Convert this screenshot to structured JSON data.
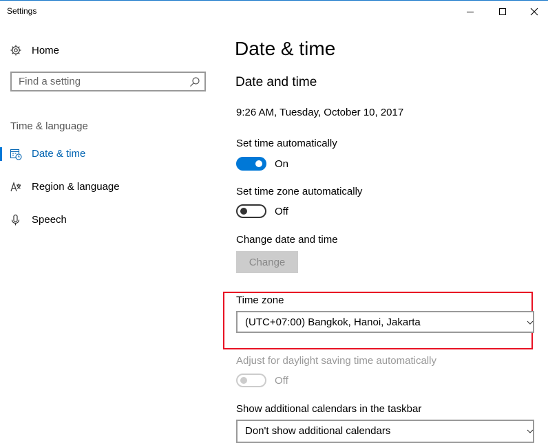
{
  "window": {
    "title": "Settings"
  },
  "sidebar": {
    "home_label": "Home",
    "search_placeholder": "Find a setting",
    "section_label": "Time & language",
    "items": [
      {
        "label": "Date & time",
        "icon": "calendar-clock-icon",
        "active": true
      },
      {
        "label": "Region & language",
        "icon": "language-icon",
        "active": false
      },
      {
        "label": "Speech",
        "icon": "microphone-icon",
        "active": false
      }
    ]
  },
  "main": {
    "page_title": "Date & time",
    "section_title": "Date and time",
    "current_datetime": "9:26 AM, Tuesday, October 10, 2017",
    "set_time_auto": {
      "label": "Set time automatically",
      "state": "On"
    },
    "set_timezone_auto": {
      "label": "Set time zone automatically",
      "state": "Off"
    },
    "change_datetime": {
      "label": "Change date and time",
      "button": "Change"
    },
    "time_zone": {
      "label": "Time zone",
      "value": "(UTC+07:00) Bangkok, Hanoi, Jakarta"
    },
    "daylight_saving": {
      "label": "Adjust for daylight saving time automatically",
      "state": "Off"
    },
    "additional_calendars": {
      "label": "Show additional calendars in the taskbar",
      "value": "Don't show additional calendars"
    }
  },
  "colors": {
    "accent": "#0078d7",
    "highlight_border": "#e81123",
    "disabled_text": "#999999"
  }
}
